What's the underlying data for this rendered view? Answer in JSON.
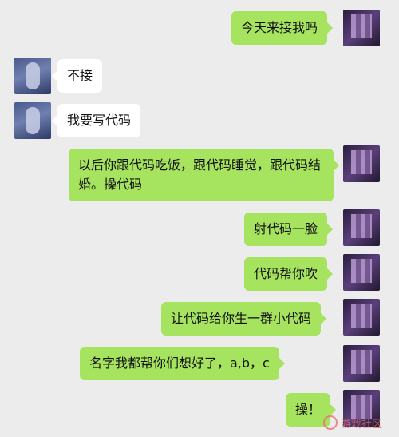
{
  "chat": {
    "messages": [
      {
        "side": "sent",
        "text": "今天来接我吗",
        "avatar": "user-avatar-icon"
      },
      {
        "side": "recv",
        "text": "不接",
        "avatar": "contact-avatar-icon"
      },
      {
        "side": "recv",
        "text": "我要写代码",
        "avatar": "contact-avatar-icon"
      },
      {
        "side": "sent",
        "text": "以后你跟代码吃饭，跟代码睡觉，跟代码结婚。操代码",
        "avatar": "user-avatar-icon"
      },
      {
        "side": "sent",
        "text": "射代码一脸",
        "avatar": "user-avatar-icon"
      },
      {
        "side": "sent",
        "text": "代码帮你吹",
        "avatar": "user-avatar-icon"
      },
      {
        "side": "sent",
        "text": "让代码给你生一群小代码",
        "avatar": "user-avatar-icon"
      },
      {
        "side": "sent",
        "text": "名字我都帮你们想好了，a,b，c",
        "avatar": "user-avatar-icon"
      },
      {
        "side": "sent",
        "text": "操！",
        "avatar": "user-avatar-icon"
      }
    ]
  },
  "colors": {
    "background": "#ececec",
    "sent_bubble": "#a6e35f",
    "received_bubble": "#ffffff"
  },
  "watermark": {
    "label": "游戏社区"
  }
}
